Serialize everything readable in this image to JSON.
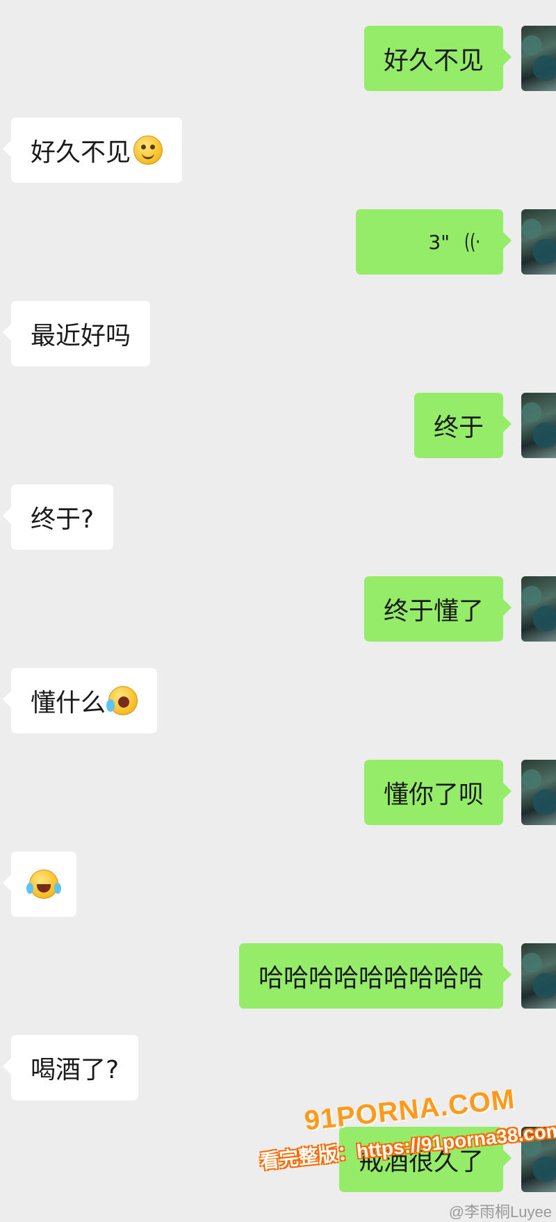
{
  "messages": [
    {
      "side": "out",
      "text": "好久不见"
    },
    {
      "side": "in",
      "text": "好久不见",
      "emoji": "smile-emoji"
    },
    {
      "side": "out",
      "type": "voice",
      "duration": "3\""
    },
    {
      "side": "in",
      "text": "最近好吗"
    },
    {
      "side": "out",
      "text": "终于"
    },
    {
      "side": "in",
      "text": "终于?"
    },
    {
      "side": "out",
      "text": "终于懂了"
    },
    {
      "side": "in",
      "text": "懂什么",
      "emoji": "crying-emoji"
    },
    {
      "side": "out",
      "text": "懂你了呗"
    },
    {
      "side": "in",
      "emoji": "tears-of-joy-emoji"
    },
    {
      "side": "out",
      "text": "哈哈哈哈哈哈哈哈哈"
    },
    {
      "side": "in",
      "text": "喝酒了?"
    },
    {
      "side": "out",
      "text": "戒酒很久了"
    }
  ],
  "watermark": {
    "brand": "91PORNA.COM",
    "notice": "看完整版：https://91porna38.com"
  },
  "credit": "@李雨桐Luyee"
}
